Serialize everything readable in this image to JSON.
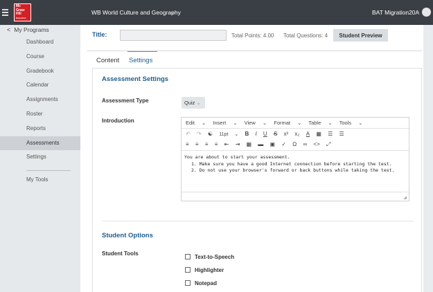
{
  "header": {
    "logo_text": "Mc Graw Hill Education",
    "course_title": "WB World Culture and Geography",
    "user_name": "BAT Migration20A"
  },
  "sidebar": {
    "back_label": "My Programs",
    "items": [
      {
        "label": "Dashboard"
      },
      {
        "label": "Course"
      },
      {
        "label": "Gradebook"
      },
      {
        "label": "Calendar"
      },
      {
        "label": "Assignments"
      },
      {
        "label": "Roster"
      },
      {
        "label": "Reports"
      },
      {
        "label": "Assessments",
        "active": true
      },
      {
        "label": "Settings"
      }
    ],
    "tools_label": "My Tools"
  },
  "main": {
    "title_label": "Title:",
    "title_value": "",
    "total_points": "Total Points: 4.00",
    "total_questions": "Total Questions: 4",
    "preview_button": "Student Preview",
    "tabs": [
      {
        "label": "Content",
        "active": false
      },
      {
        "label": "Settings",
        "active": true
      }
    ]
  },
  "assessment_settings": {
    "section_title": "Assessment Settings",
    "type_label": "Assessment Type",
    "type_value": "Quiz",
    "intro_label": "Introduction",
    "editor_menu": [
      "Edit",
      "Insert",
      "View",
      "Format",
      "Table",
      "Tools"
    ],
    "font_size": "11pt",
    "intro_text": "You are about to start your assessment.",
    "intro_list": [
      "1. Make sure you have a good Internet connection before starting the test.",
      "2. Do not use your browser's forward or back buttons while taking the test."
    ]
  },
  "student_options": {
    "section_title": "Student Options",
    "tools_label": "Student Tools",
    "tools": [
      {
        "label": "Text-to-Speech",
        "checked": false
      },
      {
        "label": "Highlighter",
        "checked": false
      },
      {
        "label": "Notepad",
        "checked": false
      }
    ]
  },
  "colors": {
    "topbar": "#3a3f45",
    "accent_blue": "#1f5e8c",
    "tab_underline": "#2aa3c9",
    "logo_red": "#d31f26"
  }
}
